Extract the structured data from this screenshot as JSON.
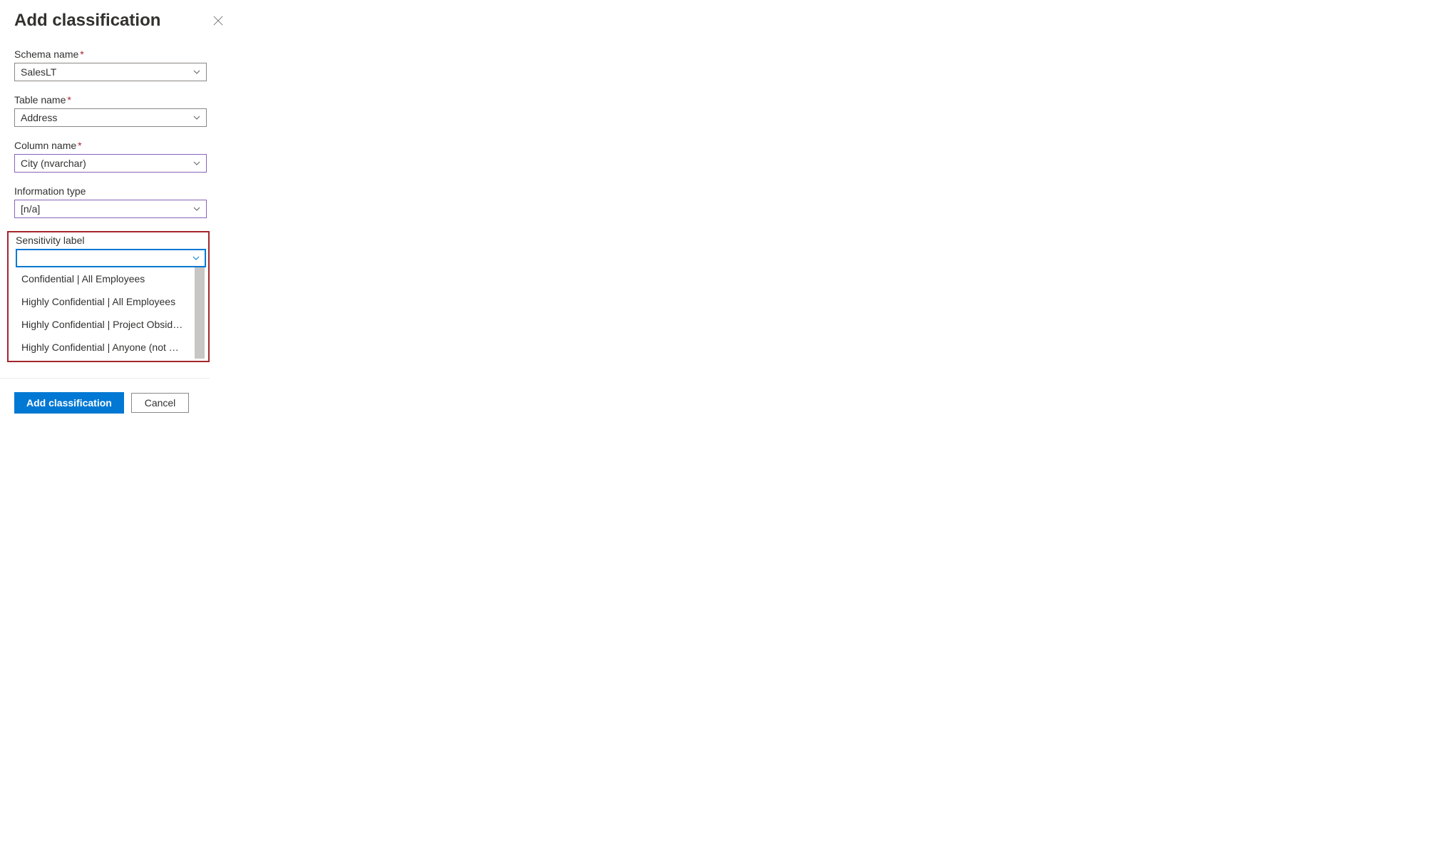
{
  "header": {
    "title": "Add classification"
  },
  "fields": {
    "schema_name": {
      "label": "Schema name",
      "value": "SalesLT",
      "required": true
    },
    "table_name": {
      "label": "Table name",
      "value": "Address",
      "required": true
    },
    "column_name": {
      "label": "Column name",
      "value": "City (nvarchar)",
      "required": true
    },
    "information_type": {
      "label": "Information type",
      "value": "[n/a]",
      "required": false
    },
    "sensitivity_label": {
      "label": "Sensitivity label",
      "value": "",
      "required": false,
      "options": [
        "Confidential | All Employees",
        "Highly Confidential | All Employees",
        "Highly Confidential | Project Obsidian",
        "Highly Confidential | Anyone (not prote..."
      ]
    }
  },
  "footer": {
    "submit_label": "Add classification",
    "cancel_label": "Cancel"
  }
}
